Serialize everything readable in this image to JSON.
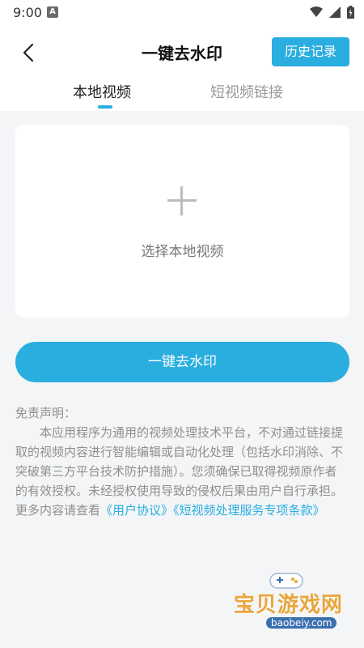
{
  "status": {
    "time": "9:00",
    "notification_glyph": "A"
  },
  "header": {
    "title": "一键去水印",
    "history_label": "历史记录"
  },
  "tabs": [
    {
      "label": "本地视频",
      "active": true
    },
    {
      "label": "短视频链接",
      "active": false
    }
  ],
  "upload": {
    "label": "选择本地视频"
  },
  "action": {
    "label": "一键去水印"
  },
  "disclaimer": {
    "title": "免责声明：",
    "body": "本应用程序为通用的视频处理技术平台，不对通过链接提取的视频内容进行智能编辑或自动化处理（包括水印消除、不突破第三方平台技术防护措施）。您须确保已取得视频原作者的有效授权。未经授权使用导致的侵权后果由用户自行承担。更多内容请查看",
    "link_user_agreement": "《用户协议》",
    "link_service_terms": "《短视频处理服务专项条款》"
  },
  "watermark": {
    "name": "宝贝游戏网",
    "url": "baobeiy.com"
  },
  "colors": {
    "accent": "#2aaee0",
    "background": "#f3f5f7",
    "card": "#ffffff"
  }
}
